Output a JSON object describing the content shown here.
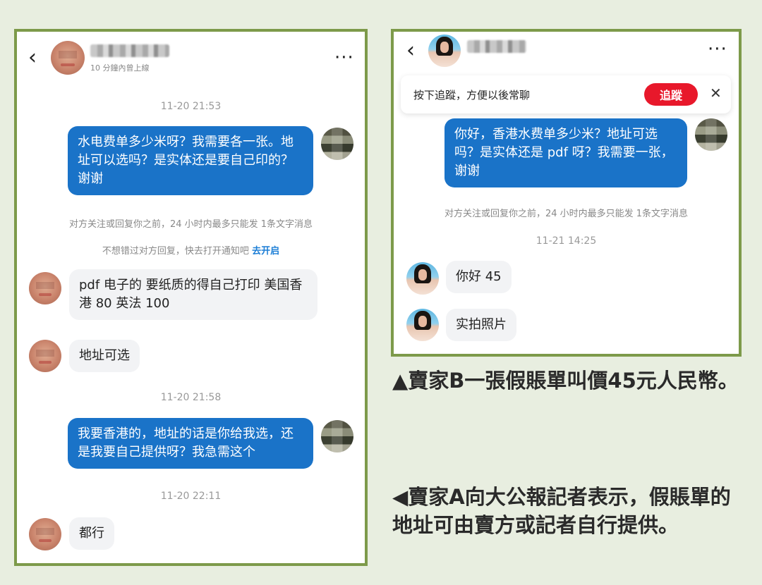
{
  "colors": {
    "frame_border": "#7d9a4a",
    "page_background": "#e8eee0",
    "outgoing_bubble": "#1a73c8",
    "incoming_bubble": "#f2f3f5",
    "follow_button": "#e8182b",
    "link": "#1c7ed6"
  },
  "icons": {
    "back": "‹",
    "more": "···",
    "close": "✕"
  },
  "chat_a": {
    "contact_status": "10 分鐘內曾上線",
    "messages": {
      "t1": "11-20 21:53",
      "m1": "水电费单多少米呀？我需要各一张。地址可以选吗？是实体还是要自己印的？谢谢",
      "note1": "对方关注或回复你之前，24 小时内最多只能发 1条文字消息",
      "note2": "不想错过对方回复，快去打开通知吧",
      "note2_link": "去开启",
      "m2": "pdf 电子的 要纸质的得自己打印 美国香港 80 英法 100",
      "m3": "地址可选",
      "t2": "11-20 21:58",
      "m4": "我要香港的，地址的话是你给我选，还是我要自己提供呀？我急需这个",
      "t3": "11-20 22:11",
      "m5": "都行"
    }
  },
  "chat_b": {
    "follow_prompt": "按下追蹤，方便以後常聊",
    "follow_button": "追蹤",
    "messages": {
      "m1": "你好，香港水费单多少米？地址可选吗？是实体还是 pdf 呀？我需要一张，谢谢",
      "note1": "对方关注或回复你之前，24 小时内最多只能发 1条文字消息",
      "t1": "11-21 14:25",
      "m2": "你好 45",
      "m3": "实拍照片"
    }
  },
  "captions": {
    "b": "▲賣家B一張假賬單叫價45元人民幣。",
    "a": "◀賣家A向大公報記者表示，假賬單的地址可由賣方或記者自行提供。"
  }
}
